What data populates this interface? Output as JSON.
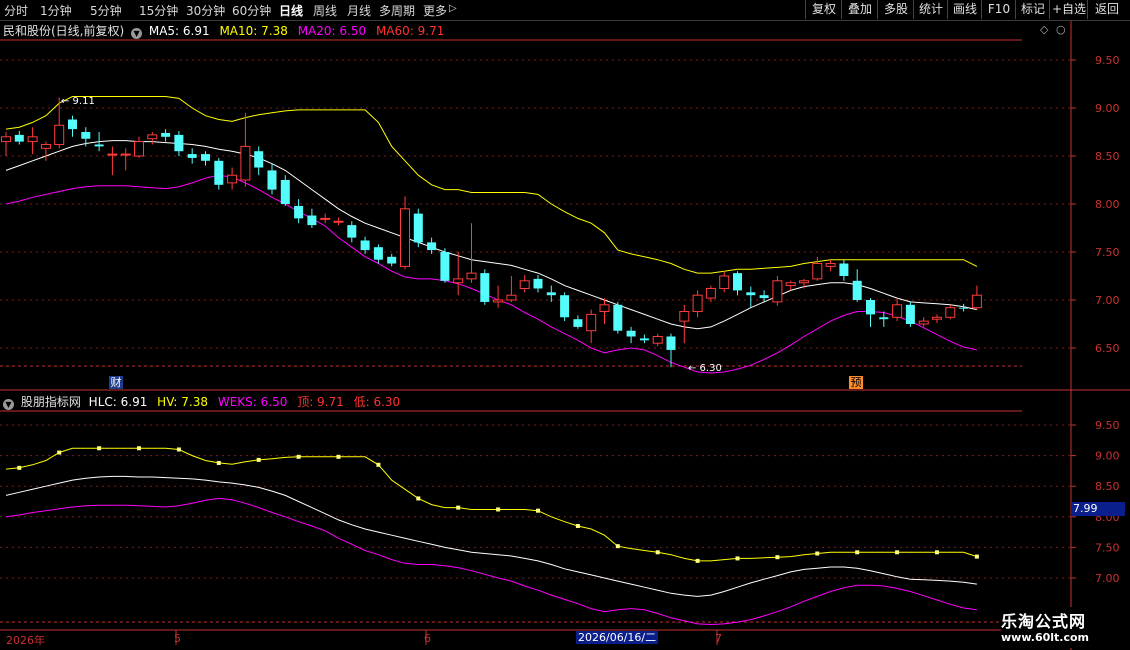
{
  "toolbar": {
    "timeframes": [
      "分时",
      "1分钟",
      "5分钟",
      "15分钟",
      "30分钟",
      "60分钟",
      "日线",
      "周线",
      "月线",
      "多周期",
      "更多"
    ],
    "active_timeframe": "日线",
    "more_arrow": "▷",
    "buttons": [
      "复权",
      "叠加",
      "多股",
      "统计",
      "画线",
      "F10",
      "标记",
      "+自选",
      "返回"
    ]
  },
  "main_panel": {
    "stock_title": "民和股份(日线,前复权)",
    "ma": [
      {
        "label": "MA5: 6.91",
        "color": "#ffffff"
      },
      {
        "label": "MA10: 7.38",
        "color": "#ffff00"
      },
      {
        "label": "MA20: 6.50",
        "color": "#ff00ff"
      },
      {
        "label": "MA60: 9.71",
        "color": "#ff3232"
      }
    ],
    "high_marker": "9.11",
    "low_marker": "6.30",
    "badge_cai": "财",
    "badge_yu": "预"
  },
  "sub_panel": {
    "indicator_name": "股朋指标网",
    "values": [
      {
        "label": "HLC: 6.91",
        "color": "#ffffff"
      },
      {
        "label": "HV: 7.38",
        "color": "#ffff00"
      },
      {
        "label": "WEKS: 6.50",
        "color": "#ff00ff"
      },
      {
        "label": "顶: 9.71",
        "color": "#ff3232"
      },
      {
        "label": "低: 6.30",
        "color": "#ff3232"
      }
    ],
    "cursor_value": "7.99"
  },
  "x_axis": {
    "year_label": "2026年",
    "month_labels": [
      "5",
      "6",
      "7"
    ],
    "cursor_date": "2026/06/16/二"
  },
  "watermark": {
    "line1": "乐淘公式网",
    "line2": "www.60lt.com"
  },
  "chart_data": [
    {
      "type": "candlestick",
      "title": "民和股份(日线,前复权)",
      "ylim": [
        6.2,
        9.75
      ],
      "y_ticks": [
        6.5,
        7.0,
        7.5,
        8.0,
        8.5,
        9.0,
        9.5
      ],
      "candles": [
        {
          "o": 8.65,
          "h": 8.75,
          "l": 8.5,
          "c": 8.7
        },
        {
          "o": 8.72,
          "h": 8.76,
          "l": 8.62,
          "c": 8.65
        },
        {
          "o": 8.65,
          "h": 8.8,
          "l": 8.52,
          "c": 8.7
        },
        {
          "o": 8.58,
          "h": 8.65,
          "l": 8.45,
          "c": 8.62
        },
        {
          "o": 8.62,
          "h": 9.11,
          "l": 8.58,
          "c": 8.82
        },
        {
          "o": 8.88,
          "h": 8.92,
          "l": 8.7,
          "c": 8.78
        },
        {
          "o": 8.75,
          "h": 8.8,
          "l": 8.6,
          "c": 8.68
        },
        {
          "o": 8.62,
          "h": 8.75,
          "l": 8.55,
          "c": 8.6
        },
        {
          "o": 8.52,
          "h": 8.6,
          "l": 8.3,
          "c": 8.52
        },
        {
          "o": 8.52,
          "h": 8.58,
          "l": 8.35,
          "c": 8.52
        },
        {
          "o": 8.5,
          "h": 8.7,
          "l": 8.48,
          "c": 8.65
        },
        {
          "o": 8.68,
          "h": 8.75,
          "l": 8.62,
          "c": 8.72
        },
        {
          "o": 8.74,
          "h": 8.78,
          "l": 8.65,
          "c": 8.7
        },
        {
          "o": 8.72,
          "h": 8.76,
          "l": 8.5,
          "c": 8.55
        },
        {
          "o": 8.52,
          "h": 8.58,
          "l": 8.42,
          "c": 8.48
        },
        {
          "o": 8.52,
          "h": 8.55,
          "l": 8.4,
          "c": 8.45
        },
        {
          "o": 8.45,
          "h": 8.48,
          "l": 8.15,
          "c": 8.2
        },
        {
          "o": 8.22,
          "h": 8.38,
          "l": 8.15,
          "c": 8.3
        },
        {
          "o": 8.25,
          "h": 8.95,
          "l": 8.18,
          "c": 8.6
        },
        {
          "o": 8.55,
          "h": 8.6,
          "l": 8.3,
          "c": 8.38
        },
        {
          "o": 8.35,
          "h": 8.42,
          "l": 8.1,
          "c": 8.15
        },
        {
          "o": 8.25,
          "h": 8.3,
          "l": 7.98,
          "c": 8.0
        },
        {
          "o": 7.98,
          "h": 8.05,
          "l": 7.8,
          "c": 7.85
        },
        {
          "o": 7.88,
          "h": 7.95,
          "l": 7.75,
          "c": 7.78
        },
        {
          "o": 7.85,
          "h": 7.9,
          "l": 7.8,
          "c": 7.85
        },
        {
          "o": 7.82,
          "h": 7.86,
          "l": 7.78,
          "c": 7.82
        },
        {
          "o": 7.78,
          "h": 7.82,
          "l": 7.6,
          "c": 7.65
        },
        {
          "o": 7.62,
          "h": 7.66,
          "l": 7.48,
          "c": 7.52
        },
        {
          "o": 7.55,
          "h": 7.58,
          "l": 7.38,
          "c": 7.42
        },
        {
          "o": 7.45,
          "h": 7.48,
          "l": 7.35,
          "c": 7.38
        },
        {
          "o": 7.35,
          "h": 8.08,
          "l": 7.32,
          "c": 7.95
        },
        {
          "o": 7.9,
          "h": 7.95,
          "l": 7.55,
          "c": 7.6
        },
        {
          "o": 7.6,
          "h": 7.65,
          "l": 7.48,
          "c": 7.52
        },
        {
          "o": 7.5,
          "h": 7.54,
          "l": 7.18,
          "c": 7.2
        },
        {
          "o": 7.18,
          "h": 7.5,
          "l": 7.05,
          "c": 7.22
        },
        {
          "o": 7.22,
          "h": 7.8,
          "l": 7.18,
          "c": 7.28
        },
        {
          "o": 7.28,
          "h": 7.32,
          "l": 6.95,
          "c": 6.98
        },
        {
          "o": 6.98,
          "h": 7.15,
          "l": 6.92,
          "c": 7.0
        },
        {
          "o": 7.0,
          "h": 7.25,
          "l": 6.98,
          "c": 7.05
        },
        {
          "o": 7.12,
          "h": 7.26,
          "l": 7.08,
          "c": 7.2
        },
        {
          "o": 7.22,
          "h": 7.26,
          "l": 7.08,
          "c": 7.12
        },
        {
          "o": 7.08,
          "h": 7.15,
          "l": 6.98,
          "c": 7.05
        },
        {
          "o": 7.05,
          "h": 7.08,
          "l": 6.78,
          "c": 6.82
        },
        {
          "o": 6.8,
          "h": 6.84,
          "l": 6.7,
          "c": 6.72
        },
        {
          "o": 6.68,
          "h": 6.9,
          "l": 6.55,
          "c": 6.85
        },
        {
          "o": 6.88,
          "h": 7.02,
          "l": 6.75,
          "c": 6.95
        },
        {
          "o": 6.95,
          "h": 6.98,
          "l": 6.65,
          "c": 6.68
        },
        {
          "o": 6.68,
          "h": 6.72,
          "l": 6.55,
          "c": 6.62
        },
        {
          "o": 6.6,
          "h": 6.64,
          "l": 6.55,
          "c": 6.58
        },
        {
          "o": 6.55,
          "h": 6.65,
          "l": 6.52,
          "c": 6.62
        },
        {
          "o": 6.62,
          "h": 6.65,
          "l": 6.3,
          "c": 6.48
        },
        {
          "o": 6.78,
          "h": 6.95,
          "l": 6.55,
          "c": 6.88
        },
        {
          "o": 6.88,
          "h": 7.1,
          "l": 6.82,
          "c": 7.05
        },
        {
          "o": 7.02,
          "h": 7.15,
          "l": 6.98,
          "c": 7.12
        },
        {
          "o": 7.12,
          "h": 7.3,
          "l": 7.08,
          "c": 7.25
        },
        {
          "o": 7.28,
          "h": 7.3,
          "l": 7.05,
          "c": 7.1
        },
        {
          "o": 7.08,
          "h": 7.14,
          "l": 6.92,
          "c": 7.05
        },
        {
          "o": 7.05,
          "h": 7.1,
          "l": 6.98,
          "c": 7.02
        },
        {
          "o": 6.98,
          "h": 7.25,
          "l": 6.94,
          "c": 7.2
        },
        {
          "o": 7.15,
          "h": 7.2,
          "l": 7.1,
          "c": 7.18
        },
        {
          "o": 7.18,
          "h": 7.22,
          "l": 7.12,
          "c": 7.2
        },
        {
          "o": 7.22,
          "h": 7.45,
          "l": 7.2,
          "c": 7.38
        },
        {
          "o": 7.35,
          "h": 7.42,
          "l": 7.3,
          "c": 7.38
        },
        {
          "o": 7.38,
          "h": 7.42,
          "l": 7.2,
          "c": 7.25
        },
        {
          "o": 7.2,
          "h": 7.32,
          "l": 6.98,
          "c": 7.0
        },
        {
          "o": 7.0,
          "h": 7.02,
          "l": 6.72,
          "c": 6.85
        },
        {
          "o": 6.82,
          "h": 6.88,
          "l": 6.72,
          "c": 6.8
        },
        {
          "o": 6.82,
          "h": 7.02,
          "l": 6.78,
          "c": 6.95
        },
        {
          "o": 6.95,
          "h": 6.98,
          "l": 6.72,
          "c": 6.75
        },
        {
          "o": 6.75,
          "h": 6.82,
          "l": 6.72,
          "c": 6.78
        },
        {
          "o": 6.8,
          "h": 6.85,
          "l": 6.76,
          "c": 6.82
        },
        {
          "o": 6.82,
          "h": 6.95,
          "l": 6.8,
          "c": 6.92
        },
        {
          "o": 6.92,
          "h": 6.96,
          "l": 6.88,
          "c": 6.91
        },
        {
          "o": 6.92,
          "h": 7.15,
          "l": 6.9,
          "c": 7.05
        }
      ],
      "series": [
        {
          "name": "MA10",
          "color": "#ffff00",
          "values": [
            8.78,
            8.8,
            8.85,
            8.92,
            9.05,
            9.12,
            9.12,
            9.12,
            9.12,
            9.12,
            9.12,
            9.12,
            9.12,
            9.1,
            9.0,
            8.92,
            8.88,
            8.86,
            8.9,
            8.93,
            8.95,
            8.97,
            8.98,
            8.98,
            8.98,
            8.98,
            8.98,
            8.98,
            8.85,
            8.6,
            8.45,
            8.3,
            8.2,
            8.15,
            8.15,
            8.12,
            8.12,
            8.12,
            8.12,
            8.12,
            8.1,
            8.0,
            7.92,
            7.85,
            7.8,
            7.7,
            7.52,
            7.48,
            7.45,
            7.42,
            7.38,
            7.32,
            7.28,
            7.28,
            7.3,
            7.32,
            7.32,
            7.33,
            7.34,
            7.35,
            7.38,
            7.4,
            7.42,
            7.42,
            7.42,
            7.42,
            7.42,
            7.42,
            7.42,
            7.42,
            7.42,
            7.42,
            7.42,
            7.35
          ]
        },
        {
          "name": "MA5",
          "color": "#ffffff",
          "values": [
            8.35,
            8.4,
            8.45,
            8.5,
            8.55,
            8.6,
            8.63,
            8.65,
            8.66,
            8.66,
            8.65,
            8.65,
            8.64,
            8.63,
            8.62,
            8.6,
            8.57,
            8.55,
            8.52,
            8.48,
            8.42,
            8.35,
            8.25,
            8.15,
            8.05,
            7.95,
            7.87,
            7.8,
            7.75,
            7.7,
            7.65,
            7.6,
            7.55,
            7.5,
            7.46,
            7.42,
            7.4,
            7.38,
            7.36,
            7.32,
            7.28,
            7.22,
            7.15,
            7.1,
            7.05,
            7.0,
            6.95,
            6.9,
            6.85,
            6.8,
            6.75,
            6.72,
            6.7,
            6.72,
            6.78,
            6.85,
            6.92,
            6.98,
            7.04,
            7.1,
            7.14,
            7.16,
            7.18,
            7.18,
            7.16,
            7.12,
            7.07,
            7.02,
            6.98,
            6.97,
            6.96,
            6.95,
            6.93,
            6.9
          ]
        },
        {
          "name": "MA20",
          "color": "#ff00ff",
          "values": [
            8.0,
            8.03,
            8.07,
            8.1,
            8.13,
            8.16,
            8.18,
            8.19,
            8.19,
            8.19,
            8.18,
            8.17,
            8.16,
            8.18,
            8.22,
            8.27,
            8.3,
            8.28,
            8.22,
            8.15,
            8.07,
            8.0,
            7.92,
            7.85,
            7.77,
            7.65,
            7.55,
            7.45,
            7.38,
            7.3,
            7.24,
            7.22,
            7.22,
            7.2,
            7.17,
            7.12,
            7.06,
            7.0,
            6.95,
            6.87,
            6.8,
            6.72,
            6.65,
            6.58,
            6.5,
            6.45,
            6.48,
            6.5,
            6.48,
            6.42,
            6.35,
            6.3,
            6.25,
            6.24,
            6.25,
            6.28,
            6.32,
            6.38,
            6.45,
            6.53,
            6.62,
            6.7,
            6.78,
            6.84,
            6.88,
            6.88,
            6.87,
            6.83,
            6.78,
            6.71,
            6.64,
            6.57,
            6.51,
            6.48
          ]
        }
      ]
    },
    {
      "type": "line",
      "title": "股朋指标网",
      "ylim": [
        6.55,
        10.05
      ],
      "y_ticks": [
        7.0,
        7.5,
        8.0,
        8.5,
        9.0,
        9.5
      ],
      "series": [
        {
          "name": "HV",
          "color": "#ffff00",
          "values": [
            8.78,
            8.8,
            8.85,
            8.92,
            9.05,
            9.12,
            9.12,
            9.12,
            9.12,
            9.12,
            9.12,
            9.12,
            9.12,
            9.1,
            9.0,
            8.92,
            8.88,
            8.86,
            8.9,
            8.93,
            8.95,
            8.97,
            8.98,
            8.98,
            8.98,
            8.98,
            8.98,
            8.98,
            8.85,
            8.6,
            8.45,
            8.3,
            8.2,
            8.15,
            8.15,
            8.12,
            8.12,
            8.12,
            8.12,
            8.12,
            8.1,
            8.0,
            7.92,
            7.85,
            7.8,
            7.7,
            7.52,
            7.48,
            7.45,
            7.42,
            7.38,
            7.32,
            7.28,
            7.28,
            7.3,
            7.32,
            7.32,
            7.33,
            7.34,
            7.35,
            7.38,
            7.4,
            7.42,
            7.42,
            7.42,
            7.42,
            7.42,
            7.42,
            7.42,
            7.42,
            7.42,
            7.42,
            7.42,
            7.35
          ]
        },
        {
          "name": "HLC",
          "color": "#ffffff",
          "values": [
            8.35,
            8.4,
            8.45,
            8.5,
            8.55,
            8.6,
            8.63,
            8.65,
            8.66,
            8.66,
            8.65,
            8.65,
            8.64,
            8.63,
            8.62,
            8.6,
            8.57,
            8.55,
            8.52,
            8.48,
            8.42,
            8.35,
            8.25,
            8.15,
            8.05,
            7.95,
            7.87,
            7.8,
            7.75,
            7.7,
            7.65,
            7.6,
            7.55,
            7.5,
            7.46,
            7.42,
            7.4,
            7.38,
            7.36,
            7.32,
            7.28,
            7.22,
            7.15,
            7.1,
            7.05,
            7.0,
            6.95,
            6.9,
            6.85,
            6.8,
            6.75,
            6.72,
            6.7,
            6.72,
            6.78,
            6.85,
            6.92,
            6.98,
            7.04,
            7.1,
            7.14,
            7.16,
            7.18,
            7.18,
            7.16,
            7.12,
            7.07,
            7.02,
            6.98,
            6.97,
            6.96,
            6.95,
            6.93,
            6.9
          ]
        },
        {
          "name": "WEKS",
          "color": "#ff00ff",
          "values": [
            8.0,
            8.03,
            8.07,
            8.1,
            8.13,
            8.16,
            8.18,
            8.19,
            8.19,
            8.19,
            8.18,
            8.17,
            8.16,
            8.18,
            8.22,
            8.27,
            8.3,
            8.28,
            8.22,
            8.15,
            8.07,
            8.0,
            7.92,
            7.85,
            7.77,
            7.65,
            7.55,
            7.45,
            7.38,
            7.3,
            7.24,
            7.22,
            7.22,
            7.2,
            7.17,
            7.12,
            7.06,
            7.0,
            6.95,
            6.87,
            6.8,
            6.72,
            6.65,
            6.58,
            6.5,
            6.45,
            6.48,
            6.5,
            6.48,
            6.42,
            6.35,
            6.3,
            6.25,
            6.24,
            6.25,
            6.28,
            6.32,
            6.38,
            6.45,
            6.53,
            6.62,
            6.7,
            6.78,
            6.84,
            6.88,
            6.88,
            6.87,
            6.83,
            6.78,
            6.71,
            6.64,
            6.57,
            6.51,
            6.48
          ]
        }
      ]
    }
  ]
}
